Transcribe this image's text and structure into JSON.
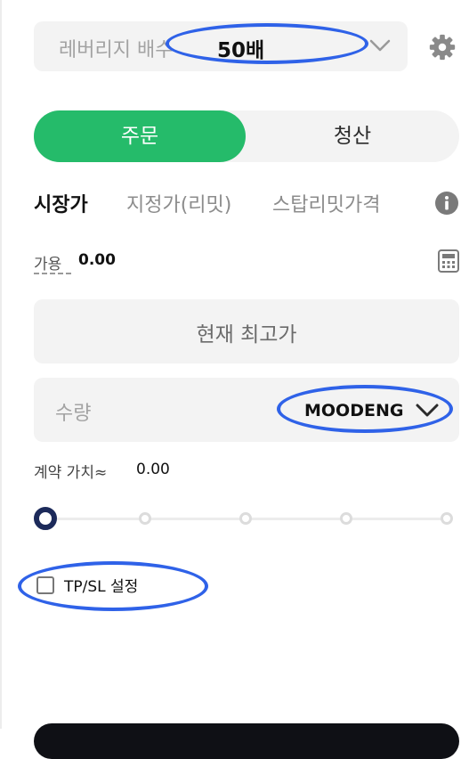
{
  "leverage": {
    "label": "레버리지 배수",
    "value": "50배"
  },
  "tabs": {
    "order": "주문",
    "close": "청산"
  },
  "order_types": {
    "market": "시장가",
    "limit": "지정가(리밋)",
    "stop": "스탑리밋가격"
  },
  "available": {
    "label": "가용",
    "value": "0.00"
  },
  "price": {
    "text": "현재 최고가"
  },
  "quantity": {
    "placeholder": "수량",
    "unit": "MOODENG"
  },
  "contract_value": {
    "label": "계약 가치≈",
    "value": "0.00"
  },
  "slider": {
    "level_percent": 0,
    "stops": 5
  },
  "tpsl": {
    "label": "TP/SL 설정",
    "checked": false
  },
  "colors": {
    "accent": "#25bb6a",
    "highlight": "#2f62e8",
    "slider_active": "#1c2a5a"
  },
  "icons": [
    "chevron-down-icon",
    "gear-icon",
    "info-icon",
    "calculator-icon"
  ]
}
